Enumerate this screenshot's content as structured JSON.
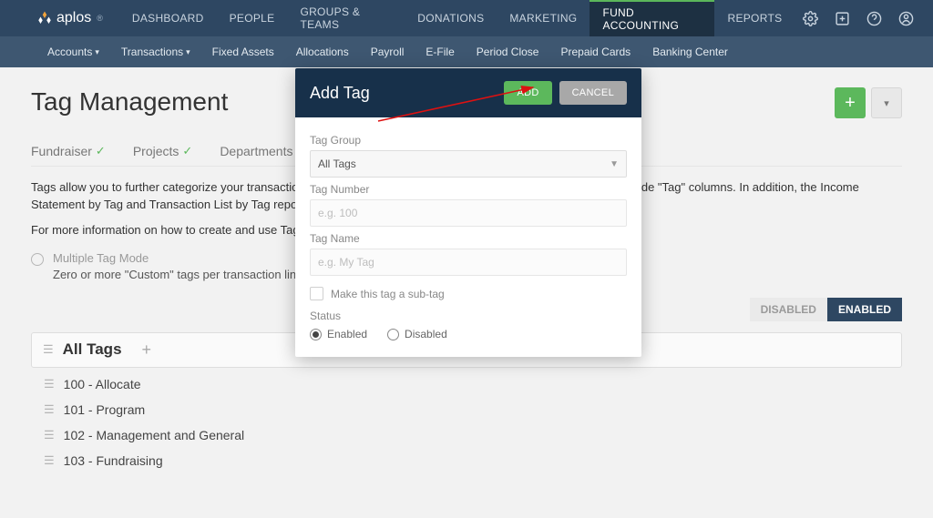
{
  "brand": "aplos",
  "nav": {
    "items": [
      "DASHBOARD",
      "PEOPLE",
      "GROUPS & TEAMS",
      "DONATIONS",
      "MARKETING",
      "FUND ACCOUNTING",
      "REPORTS"
    ],
    "active": "FUND ACCOUNTING"
  },
  "subnav": {
    "items": [
      {
        "label": "Accounts",
        "dd": true
      },
      {
        "label": "Transactions",
        "dd": true
      },
      {
        "label": "Fixed Assets",
        "dd": false
      },
      {
        "label": "Allocations",
        "dd": false
      },
      {
        "label": "Payroll",
        "dd": false
      },
      {
        "label": "E-File",
        "dd": false
      },
      {
        "label": "Period Close",
        "dd": false
      },
      {
        "label": "Prepaid Cards",
        "dd": false
      },
      {
        "label": "Banking Center",
        "dd": false
      }
    ]
  },
  "page": {
    "title": "Tag Management",
    "tabs": [
      "Fundraiser",
      "Projects",
      "Departments"
    ],
    "desc1": "Tags allow you to further categorize your transactions. When tags are enabled, all transaction entry screens will include \"Tag\" columns. In addition, the Income Statement by Tag and Transaction List by Tag reports will be available.",
    "desc2": "For more information on how to create and use Tags, click here.",
    "mode_title": "Multiple Tag Mode",
    "mode_body": "Zero or more \"Custom\" tags per transaction line. Tags cannot be required.",
    "toggles": {
      "off": "DISABLED",
      "on": "ENABLED"
    },
    "group": {
      "title": "All Tags",
      "tags": [
        "100 - Allocate",
        "101 - Program",
        "102 - Management and General",
        "103 - Fundraising"
      ]
    }
  },
  "modal": {
    "title": "Add Tag",
    "add": "ADD",
    "cancel": "CANCEL",
    "group_label": "Tag Group",
    "group_value": "All Tags",
    "number_label": "Tag Number",
    "number_ph": "e.g. 100",
    "name_label": "Tag Name",
    "name_ph": "e.g. My Tag",
    "subtag": "Make this tag a sub-tag",
    "status_label": "Status",
    "status_en": "Enabled",
    "status_dis": "Disabled"
  }
}
